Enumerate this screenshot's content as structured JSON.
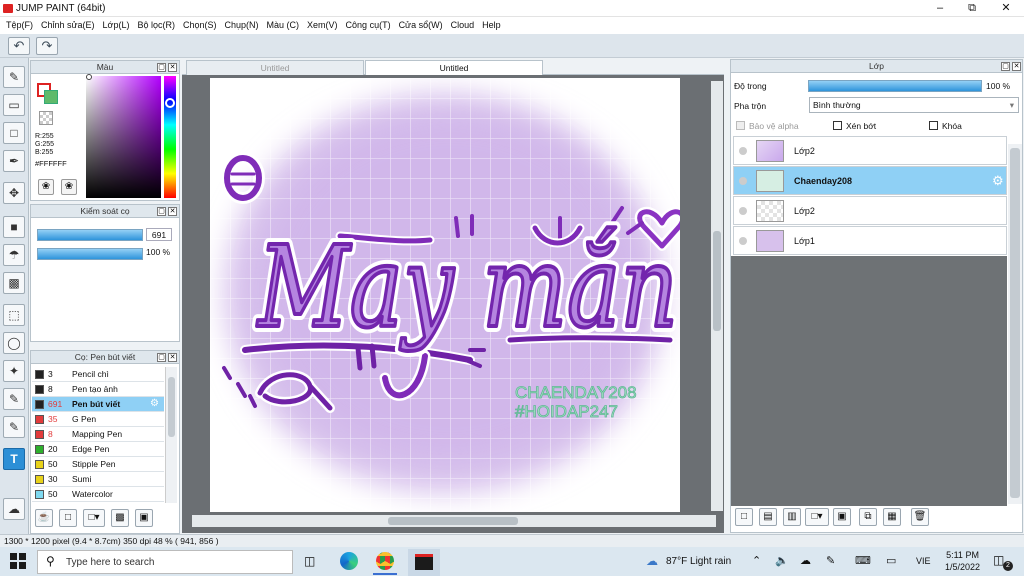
{
  "app": {
    "title": "JUMP PAINT (64bit)"
  },
  "menu": [
    "Tệp(F)",
    "Chỉnh sửa(E)",
    "Lớp(L)",
    "Bộ lọc(R)",
    "Chọn(S)",
    "Chụp(N)",
    "Màu (C)",
    "Xem(V)",
    "Công cụ(T)",
    "Cửa sổ(W)",
    "Cloud",
    "Help"
  ],
  "panels": {
    "color_title": "Màu",
    "brush_control_title": "Kiểm soát cọ",
    "brush_list_title": "Cọ: Pen bút viết",
    "layer_title": "Lớp"
  },
  "color": {
    "r": "R:255",
    "g": "G:255",
    "b": "B:255",
    "hex": "#FFFFFF"
  },
  "brush_control": {
    "size": "691",
    "opacity": "100 %",
    "size_fraction": 0.96,
    "opacity_fraction": 1.0
  },
  "brushes": [
    {
      "size": "3",
      "name": "Pencil chì",
      "color": "#222222"
    },
    {
      "size": "8",
      "name": "Pen tạo ảnh",
      "color": "#222222"
    },
    {
      "size": "691",
      "name": "Pen bút viết",
      "color": "#222222",
      "selected": true
    },
    {
      "size": "35",
      "name": "G Pen",
      "color": "#e23b3b"
    },
    {
      "size": "8",
      "name": "Mapping Pen",
      "color": "#e23b3b"
    },
    {
      "size": "20",
      "name": "Edge Pen",
      "color": "#2db02d"
    },
    {
      "size": "50",
      "name": "Stipple Pen",
      "color": "#e8d21a"
    },
    {
      "size": "30",
      "name": "Sumi",
      "color": "#e8d21a"
    },
    {
      "size": "50",
      "name": "Watercolor",
      "color": "#7fd9f0"
    }
  ],
  "tabs": [
    "Untitled",
    "Untitled"
  ],
  "artwork": {
    "main_text": "May mắn",
    "credit_1": "CHAENDAY208",
    "credit_2": "#HOIDAP247"
  },
  "layer_props": {
    "opacity_label": "Độ trong",
    "opacity_value": "100 %",
    "blend_label": "Pha trộn",
    "blend_value": "Bình thường",
    "protect_alpha": "Bảo vệ alpha",
    "clip": "Xén bớt",
    "lock": "Khóa"
  },
  "layers": [
    {
      "name": "Lớp2",
      "selected": false
    },
    {
      "name": "Chaenday208",
      "selected": true
    },
    {
      "name": "Lớp2",
      "selected": false
    },
    {
      "name": "Lớp1",
      "selected": false
    }
  ],
  "status": "1300 * 1200 pixel  (9.4 * 8.7cm)  350 dpi  48 %  ( 941, 856 )",
  "taskbar": {
    "search_placeholder": "Type here to search",
    "weather": "87°F  Light rain",
    "lang": "VIE",
    "time": "5:11 PM",
    "date": "1/5/2022",
    "notif": "2"
  }
}
